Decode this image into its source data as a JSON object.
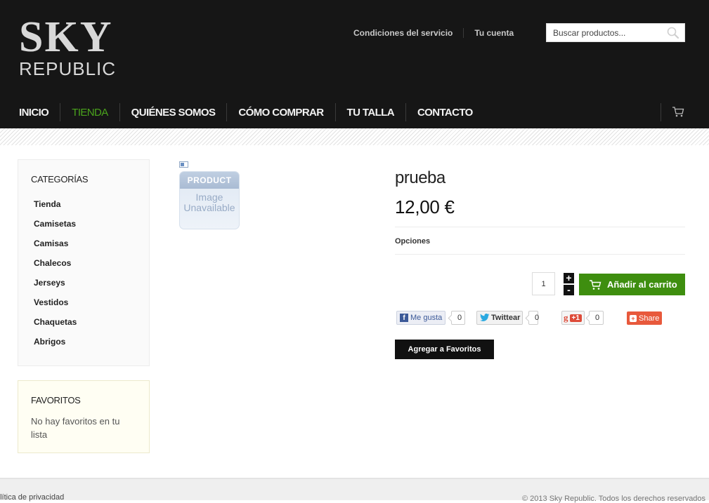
{
  "logo": {
    "line1": "SKY",
    "line2": "REPUBLIC"
  },
  "toplinks": {
    "terms": "Condiciones del servicio",
    "account": "Tu cuenta"
  },
  "search": {
    "placeholder": "Buscar productos..."
  },
  "nav": {
    "items": [
      "INICIO",
      "TIENDA",
      "QUIÉNES SOMOS",
      "CÓMO COMPRAR",
      "TU TALLA",
      "CONTACTO"
    ],
    "active_index": 1,
    "active_color": "#4aa31c"
  },
  "sidebar": {
    "categories_title": "CATEGORÍAS",
    "categories": [
      "Tienda",
      "Camisetas",
      "Camisas",
      "Chalecos",
      "Jerseys",
      "Vestidos",
      "Chaquetas",
      "Abrigos"
    ],
    "favorites_title": "FAVORITOS",
    "favorites_text": "No hay favoritos en tu lista"
  },
  "product": {
    "image_band": "PRODUCT",
    "image_text": "Image Unavailable",
    "title": "prueba",
    "price": "12,00 €",
    "options_label": "Opciones",
    "quantity": "1",
    "plus": "+",
    "minus": "-",
    "add_to_cart": "Añadir al carrito",
    "add_to_cart_color": "#3e8e0f",
    "add_favorite": "Agregar a Favoritos"
  },
  "social": {
    "fb_label": "Me gusta",
    "fb_count": "0",
    "tw_label": "Twittear",
    "tw_count": "0",
    "gp_label": "+1",
    "gp_count": "0",
    "share_label": "Share"
  },
  "footer": {
    "left": "olítica de privacidad",
    "right": "© 2013 Sky Republic. Todos los derechos reservados"
  }
}
